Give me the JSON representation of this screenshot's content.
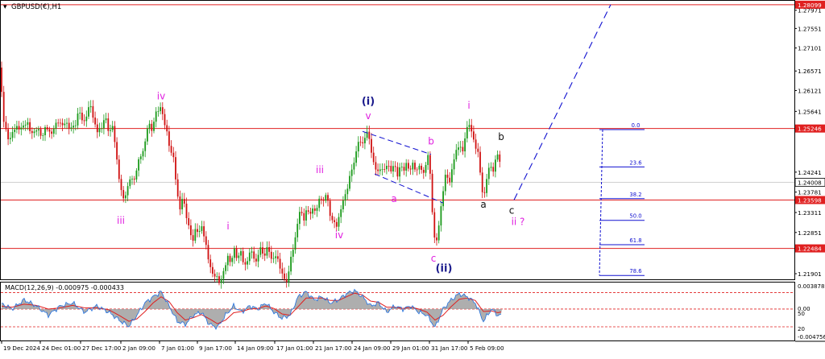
{
  "window": {
    "symbol_title": "GBPUSD(€),H1",
    "menu_glyph": "▾"
  },
  "colors": {
    "candle_up": "#1a9a1a",
    "candle_down": "#d01010",
    "hline": "#e02020",
    "fib": "#1010d0",
    "wave_magenta": "#e020e0",
    "wave_navy": "#1a1a8c",
    "wave_black": "#111111",
    "macd_fill": "#a0a0a0",
    "macd_signal": "#e02020",
    "macd_line": "#1e6fe0",
    "price_box": "#e02020",
    "current_box": "#ffffff"
  },
  "chart_data": [
    {
      "type": "candlestick",
      "symbol": "GBPUSD",
      "timeframe": "H1",
      "y_axis_ticks": [
        "1.27971",
        "1.27551",
        "1.27101",
        "1.26571",
        "1.26121",
        "1.25641",
        "1.24241",
        "1.23781",
        "1.23311",
        "1.22851",
        "1.21901"
      ],
      "ylim": [
        1.2179,
        1.2817
      ],
      "x_axis_labels": [
        "19 Dec 2024",
        "24 Dec 01:00",
        "27 Dec 17:00",
        "2 Jan 09:00",
        "7 Jan 01:00",
        "9 Jan 17:00",
        "14 Jan 09:00",
        "17 Jan 01:00",
        "21 Jan 17:00",
        "24 Jan 09:00",
        "29 Jan 01:00",
        "31 Jan 17:00",
        "5 Feb 09:00"
      ],
      "close_path": [
        [
          0,
          1.2665
        ],
        [
          5,
          1.253
        ],
        [
          12,
          1.2498
        ],
        [
          20,
          1.2532
        ],
        [
          26,
          1.2521
        ],
        [
          33,
          1.2544
        ],
        [
          38,
          1.2512
        ],
        [
          45,
          1.2523
        ],
        [
          52,
          1.2508
        ],
        [
          57,
          1.2527
        ],
        [
          63,
          1.2513
        ],
        [
          69,
          1.253
        ],
        [
          73,
          1.2547
        ],
        [
          77,
          1.2528
        ],
        [
          82,
          1.254
        ],
        [
          88,
          1.2522
        ],
        [
          93,
          1.2532
        ],
        [
          98,
          1.2568
        ],
        [
          103,
          1.2535
        ],
        [
          108,
          1.256
        ],
        [
          113,
          1.2578
        ],
        [
          117,
          1.2538
        ],
        [
          121,
          1.2515
        ],
        [
          126,
          1.2528
        ],
        [
          130,
          1.2552
        ],
        [
          135,
          1.2518
        ],
        [
          140,
          1.253
        ],
        [
          145,
          1.2452
        ],
        [
          150,
          1.2385
        ],
        [
          153,
          1.2358
        ],
        [
          157,
          1.2382
        ],
        [
          162,
          1.2412
        ],
        [
          166,
          1.24
        ],
        [
          170,
          1.244
        ],
        [
          175,
          1.246
        ],
        [
          180,
          1.2492
        ],
        [
          184,
          1.2538
        ],
        [
          188,
          1.252
        ],
        [
          192,
          1.2552
        ],
        [
          196,
          1.2565
        ],
        [
          200,
          1.2578
        ],
        [
          204,
          1.2535
        ],
        [
          208,
          1.2508
        ],
        [
          212,
          1.2472
        ],
        [
          216,
          1.245
        ],
        [
          219,
          1.239
        ],
        [
          223,
          1.2338
        ],
        [
          227,
          1.2365
        ],
        [
          231,
          1.233
        ],
        [
          235,
          1.229
        ],
        [
          239,
          1.2262
        ],
        [
          243,
          1.23
        ],
        [
          247,
          1.2278
        ],
        [
          251,
          1.2305
        ],
        [
          255,
          1.226
        ],
        [
          259,
          1.2218
        ],
        [
          263,
          1.2195
        ],
        [
          268,
          1.218
        ],
        [
          273,
          1.2172
        ],
        [
          278,
          1.2195
        ],
        [
          283,
          1.2232
        ],
        [
          287,
          1.2215
        ],
        [
          291,
          1.2245
        ],
        [
          295,
          1.2226
        ],
        [
          299,
          1.224
        ],
        [
          303,
          1.2205
        ],
        [
          308,
          1.2228
        ],
        [
          313,
          1.2242
        ],
        [
          318,
          1.2215
        ],
        [
          323,
          1.225
        ],
        [
          328,
          1.2232
        ],
        [
          333,
          1.225
        ],
        [
          338,
          1.222
        ],
        [
          343,
          1.2232
        ],
        [
          348,
          1.2205
        ],
        [
          353,
          1.2172
        ],
        [
          357,
          1.2178
        ],
        [
          361,
          1.2228
        ],
        [
          365,
          1.225
        ],
        [
          369,
          1.231
        ],
        [
          373,
          1.2335
        ],
        [
          377,
          1.2315
        ],
        [
          381,
          1.2342
        ],
        [
          385,
          1.2322
        ],
        [
          389,
          1.2348
        ],
        [
          393,
          1.233
        ],
        [
          397,
          1.2372
        ],
        [
          401,
          1.2355
        ],
        [
          405,
          1.2375
        ],
        [
          409,
          1.2332
        ],
        [
          413,
          1.2312
        ],
        [
          417,
          1.2295
        ],
        [
          421,
          1.2325
        ],
        [
          425,
          1.2352
        ],
        [
          429,
          1.2372
        ],
        [
          433,
          1.2408
        ],
        [
          437,
          1.2428
        ],
        [
          441,
          1.2462
        ],
        [
          445,
          1.2498
        ],
        [
          449,
          1.2482
        ],
        [
          453,
          1.251
        ],
        [
          457,
          1.2514
        ],
        [
          461,
          1.247
        ],
        [
          465,
          1.2438
        ],
        [
          469,
          1.242
        ],
        [
          473,
          1.244
        ],
        [
          477,
          1.2425
        ],
        [
          481,
          1.2445
        ],
        [
          485,
          1.2428
        ],
        [
          489,
          1.244
        ],
        [
          493,
          1.2418
        ],
        [
          497,
          1.244
        ],
        [
          501,
          1.2425
        ],
        [
          505,
          1.245
        ],
        [
          509,
          1.2422
        ],
        [
          513,
          1.2448
        ],
        [
          517,
          1.2425
        ],
        [
          521,
          1.244
        ],
        [
          525,
          1.2418
        ],
        [
          529,
          1.2448
        ],
        [
          532,
          1.246
        ],
        [
          535,
          1.24
        ],
        [
          538,
          1.228
        ],
        [
          541,
          1.2258
        ],
        [
          544,
          1.2285
        ],
        [
          547,
          1.2345
        ],
        [
          550,
          1.238
        ],
        [
          554,
          1.2425
        ],
        [
          558,
          1.24
        ],
        [
          562,
          1.244
        ],
        [
          566,
          1.2472
        ],
        [
          570,
          1.2492
        ],
        [
          574,
          1.2462
        ],
        [
          578,
          1.252
        ],
        [
          582,
          1.2536
        ],
        [
          586,
          1.251
        ],
        [
          590,
          1.2488
        ],
        [
          594,
          1.246
        ],
        [
          598,
          1.2385
        ],
        [
          601,
          1.237
        ],
        [
          605,
          1.242
        ],
        [
          609,
          1.2442
        ],
        [
          613,
          1.2425
        ],
        [
          617,
          1.247
        ],
        [
          620,
          1.2455
        ],
        [
          623,
          1.2401
        ]
      ],
      "horizontal_levels": [
        {
          "price": 1.28099,
          "label": "1.28099"
        },
        {
          "price": 1.25246,
          "label": "1.25246"
        },
        {
          "price": 1.23598,
          "label": "1.23598"
        },
        {
          "price": 1.22484,
          "label": "1.22484"
        }
      ],
      "current_price": {
        "price": 1.24008,
        "label": "1.24008"
      },
      "fibonacci": {
        "levels": [
          {
            "ratio": "0.0",
            "price": 1.2522
          },
          {
            "ratio": "23.6",
            "price": 1.2436
          },
          {
            "ratio": "38.2",
            "price": 1.2363
          },
          {
            "ratio": "50.0",
            "price": 1.2313
          },
          {
            "ratio": "61.8",
            "price": 1.2257
          },
          {
            "ratio": "78.6",
            "price": 1.2186
          }
        ]
      },
      "wave_labels": [
        {
          "text": "iv",
          "color": "magenta",
          "x": 200,
          "price": 1.2592
        },
        {
          "text": "iii",
          "color": "magenta",
          "x": 150,
          "price": 1.2305
        },
        {
          "text": "i",
          "color": "magenta",
          "x": 283,
          "price": 1.2292
        },
        {
          "text": "iii",
          "color": "magenta",
          "x": 397,
          "price": 1.2422
        },
        {
          "text": "iv",
          "color": "magenta",
          "x": 421,
          "price": 1.2272
        },
        {
          "text": "(i)",
          "color": "navy",
          "x": 457,
          "price": 1.258
        },
        {
          "text": "v",
          "color": "magenta",
          "x": 457,
          "price": 1.2546
        },
        {
          "text": "a",
          "color": "magenta",
          "x": 489,
          "price": 1.2355
        },
        {
          "text": "b",
          "color": "magenta",
          "x": 535,
          "price": 1.2488
        },
        {
          "text": "c",
          "color": "magenta",
          "x": 538,
          "price": 1.2218
        },
        {
          "text": "(ii)",
          "color": "navy",
          "x": 551,
          "price": 1.2195
        },
        {
          "text": "i",
          "color": "magenta",
          "x": 582,
          "price": 1.257
        },
        {
          "text": "b",
          "color": "black",
          "x": 622,
          "price": 1.2498
        },
        {
          "text": "a",
          "color": "black",
          "x": 600,
          "price": 1.2342
        },
        {
          "text": "c",
          "color": "black",
          "x": 635,
          "price": 1.2328
        },
        {
          "text": "ii ?",
          "color": "magenta",
          "x": 643,
          "price": 1.2302
        }
      ],
      "channel_lines": [
        {
          "from": [
            450,
            1.2518
          ],
          "to": [
            535,
            1.2465
          ]
        },
        {
          "from": [
            465,
            1.242
          ],
          "to": [
            550,
            1.2353
          ]
        }
      ],
      "projection_line": {
        "from": [
          638,
          1.236
        ],
        "to": [
          758,
          1.281
        ]
      }
    },
    {
      "type": "line",
      "title": "MACD(12,26,9) -0.000975 -0.000433",
      "y_axis_ticks": [
        "0.003878",
        "0.00",
        "50",
        "20",
        "-0.004756"
      ],
      "ylim": [
        -0.005,
        0.0042
      ],
      "reference_levels": [
        0.0027,
        0.0,
        -0.0029
      ],
      "series": [
        {
          "name": "MACD",
          "kind": "histogram"
        },
        {
          "name": "Signal",
          "kind": "line"
        }
      ],
      "macd": [
        [
          0,
          0.001
        ],
        [
          15,
          0.0
        ],
        [
          30,
          0.0015
        ],
        [
          45,
          0.0005
        ],
        [
          60,
          -0.001
        ],
        [
          75,
          0.0005
        ],
        [
          90,
          0.001
        ],
        [
          105,
          -0.0005
        ],
        [
          120,
          0.0005
        ],
        [
          135,
          -0.0005
        ],
        [
          150,
          -0.002
        ],
        [
          160,
          -0.0028
        ],
        [
          170,
          -0.001
        ],
        [
          180,
          0.001
        ],
        [
          190,
          0.002
        ],
        [
          200,
          0.0028
        ],
        [
          210,
          0.0005
        ],
        [
          220,
          -0.002
        ],
        [
          230,
          -0.0025
        ],
        [
          240,
          -0.001
        ],
        [
          250,
          -0.0005
        ],
        [
          260,
          -0.0025
        ],
        [
          270,
          -0.003
        ],
        [
          280,
          -0.001
        ],
        [
          290,
          0.0005
        ],
        [
          300,
          -0.0005
        ],
        [
          310,
          0.0005
        ],
        [
          320,
          0.0
        ],
        [
          330,
          0.001
        ],
        [
          340,
          -0.0005
        ],
        [
          350,
          -0.0015
        ],
        [
          360,
          -0.001
        ],
        [
          370,
          0.002
        ],
        [
          380,
          0.0028
        ],
        [
          390,
          0.0015
        ],
        [
          400,
          0.002
        ],
        [
          410,
          0.001
        ],
        [
          420,
          0.0015
        ],
        [
          430,
          0.0025
        ],
        [
          440,
          0.003
        ],
        [
          450,
          0.002
        ],
        [
          460,
          0.0005
        ],
        [
          470,
          0.001
        ],
        [
          480,
          -0.0005
        ],
        [
          490,
          0.0005
        ],
        [
          500,
          0.0
        ],
        [
          510,
          0.0005
        ],
        [
          520,
          -0.0005
        ],
        [
          530,
          -0.001
        ],
        [
          540,
          -0.003
        ],
        [
          550,
          0.0
        ],
        [
          560,
          0.0015
        ],
        [
          570,
          0.0025
        ],
        [
          580,
          0.002
        ],
        [
          590,
          0.001
        ],
        [
          600,
          -0.002
        ],
        [
          610,
          0.0
        ],
        [
          618,
          -0.001
        ],
        [
          623,
          -0.000975
        ]
      ],
      "signal": [
        [
          0,
          0.0005
        ],
        [
          15,
          0.0003
        ],
        [
          30,
          0.0008
        ],
        [
          45,
          0.0006
        ],
        [
          60,
          0.0
        ],
        [
          75,
          0.0002
        ],
        [
          90,
          0.0006
        ],
        [
          105,
          0.0002
        ],
        [
          120,
          0.0002
        ],
        [
          135,
          -0.0001
        ],
        [
          150,
          -0.0012
        ],
        [
          160,
          -0.002
        ],
        [
          170,
          -0.0016
        ],
        [
          180,
          -0.0004
        ],
        [
          190,
          0.001
        ],
        [
          200,
          0.002
        ],
        [
          210,
          0.0012
        ],
        [
          220,
          -0.0006
        ],
        [
          230,
          -0.0018
        ],
        [
          240,
          -0.0014
        ],
        [
          250,
          -0.0009
        ],
        [
          260,
          -0.0016
        ],
        [
          270,
          -0.0024
        ],
        [
          280,
          -0.0018
        ],
        [
          290,
          -0.0006
        ],
        [
          300,
          -0.0004
        ],
        [
          310,
          0.0
        ],
        [
          320,
          0.0001
        ],
        [
          330,
          0.0005
        ],
        [
          340,
          0.0001
        ],
        [
          350,
          -0.0008
        ],
        [
          360,
          -0.001
        ],
        [
          370,
          0.0004
        ],
        [
          380,
          0.0018
        ],
        [
          390,
          0.0018
        ],
        [
          400,
          0.0018
        ],
        [
          410,
          0.0014
        ],
        [
          420,
          0.0014
        ],
        [
          430,
          0.002
        ],
        [
          440,
          0.0026
        ],
        [
          450,
          0.0023
        ],
        [
          460,
          0.0013
        ],
        [
          470,
          0.0011
        ],
        [
          480,
          0.0003
        ],
        [
          490,
          0.0003
        ],
        [
          500,
          0.0001
        ],
        [
          510,
          0.0003
        ],
        [
          520,
          0.0
        ],
        [
          530,
          -0.0005
        ],
        [
          540,
          -0.0018
        ],
        [
          550,
          -0.001
        ],
        [
          560,
          0.0004
        ],
        [
          570,
          0.0016
        ],
        [
          580,
          0.0018
        ],
        [
          590,
          0.0014
        ],
        [
          600,
          -0.0004
        ],
        [
          610,
          -0.0003
        ],
        [
          618,
          -0.0006
        ],
        [
          623,
          -0.000433
        ]
      ]
    }
  ]
}
